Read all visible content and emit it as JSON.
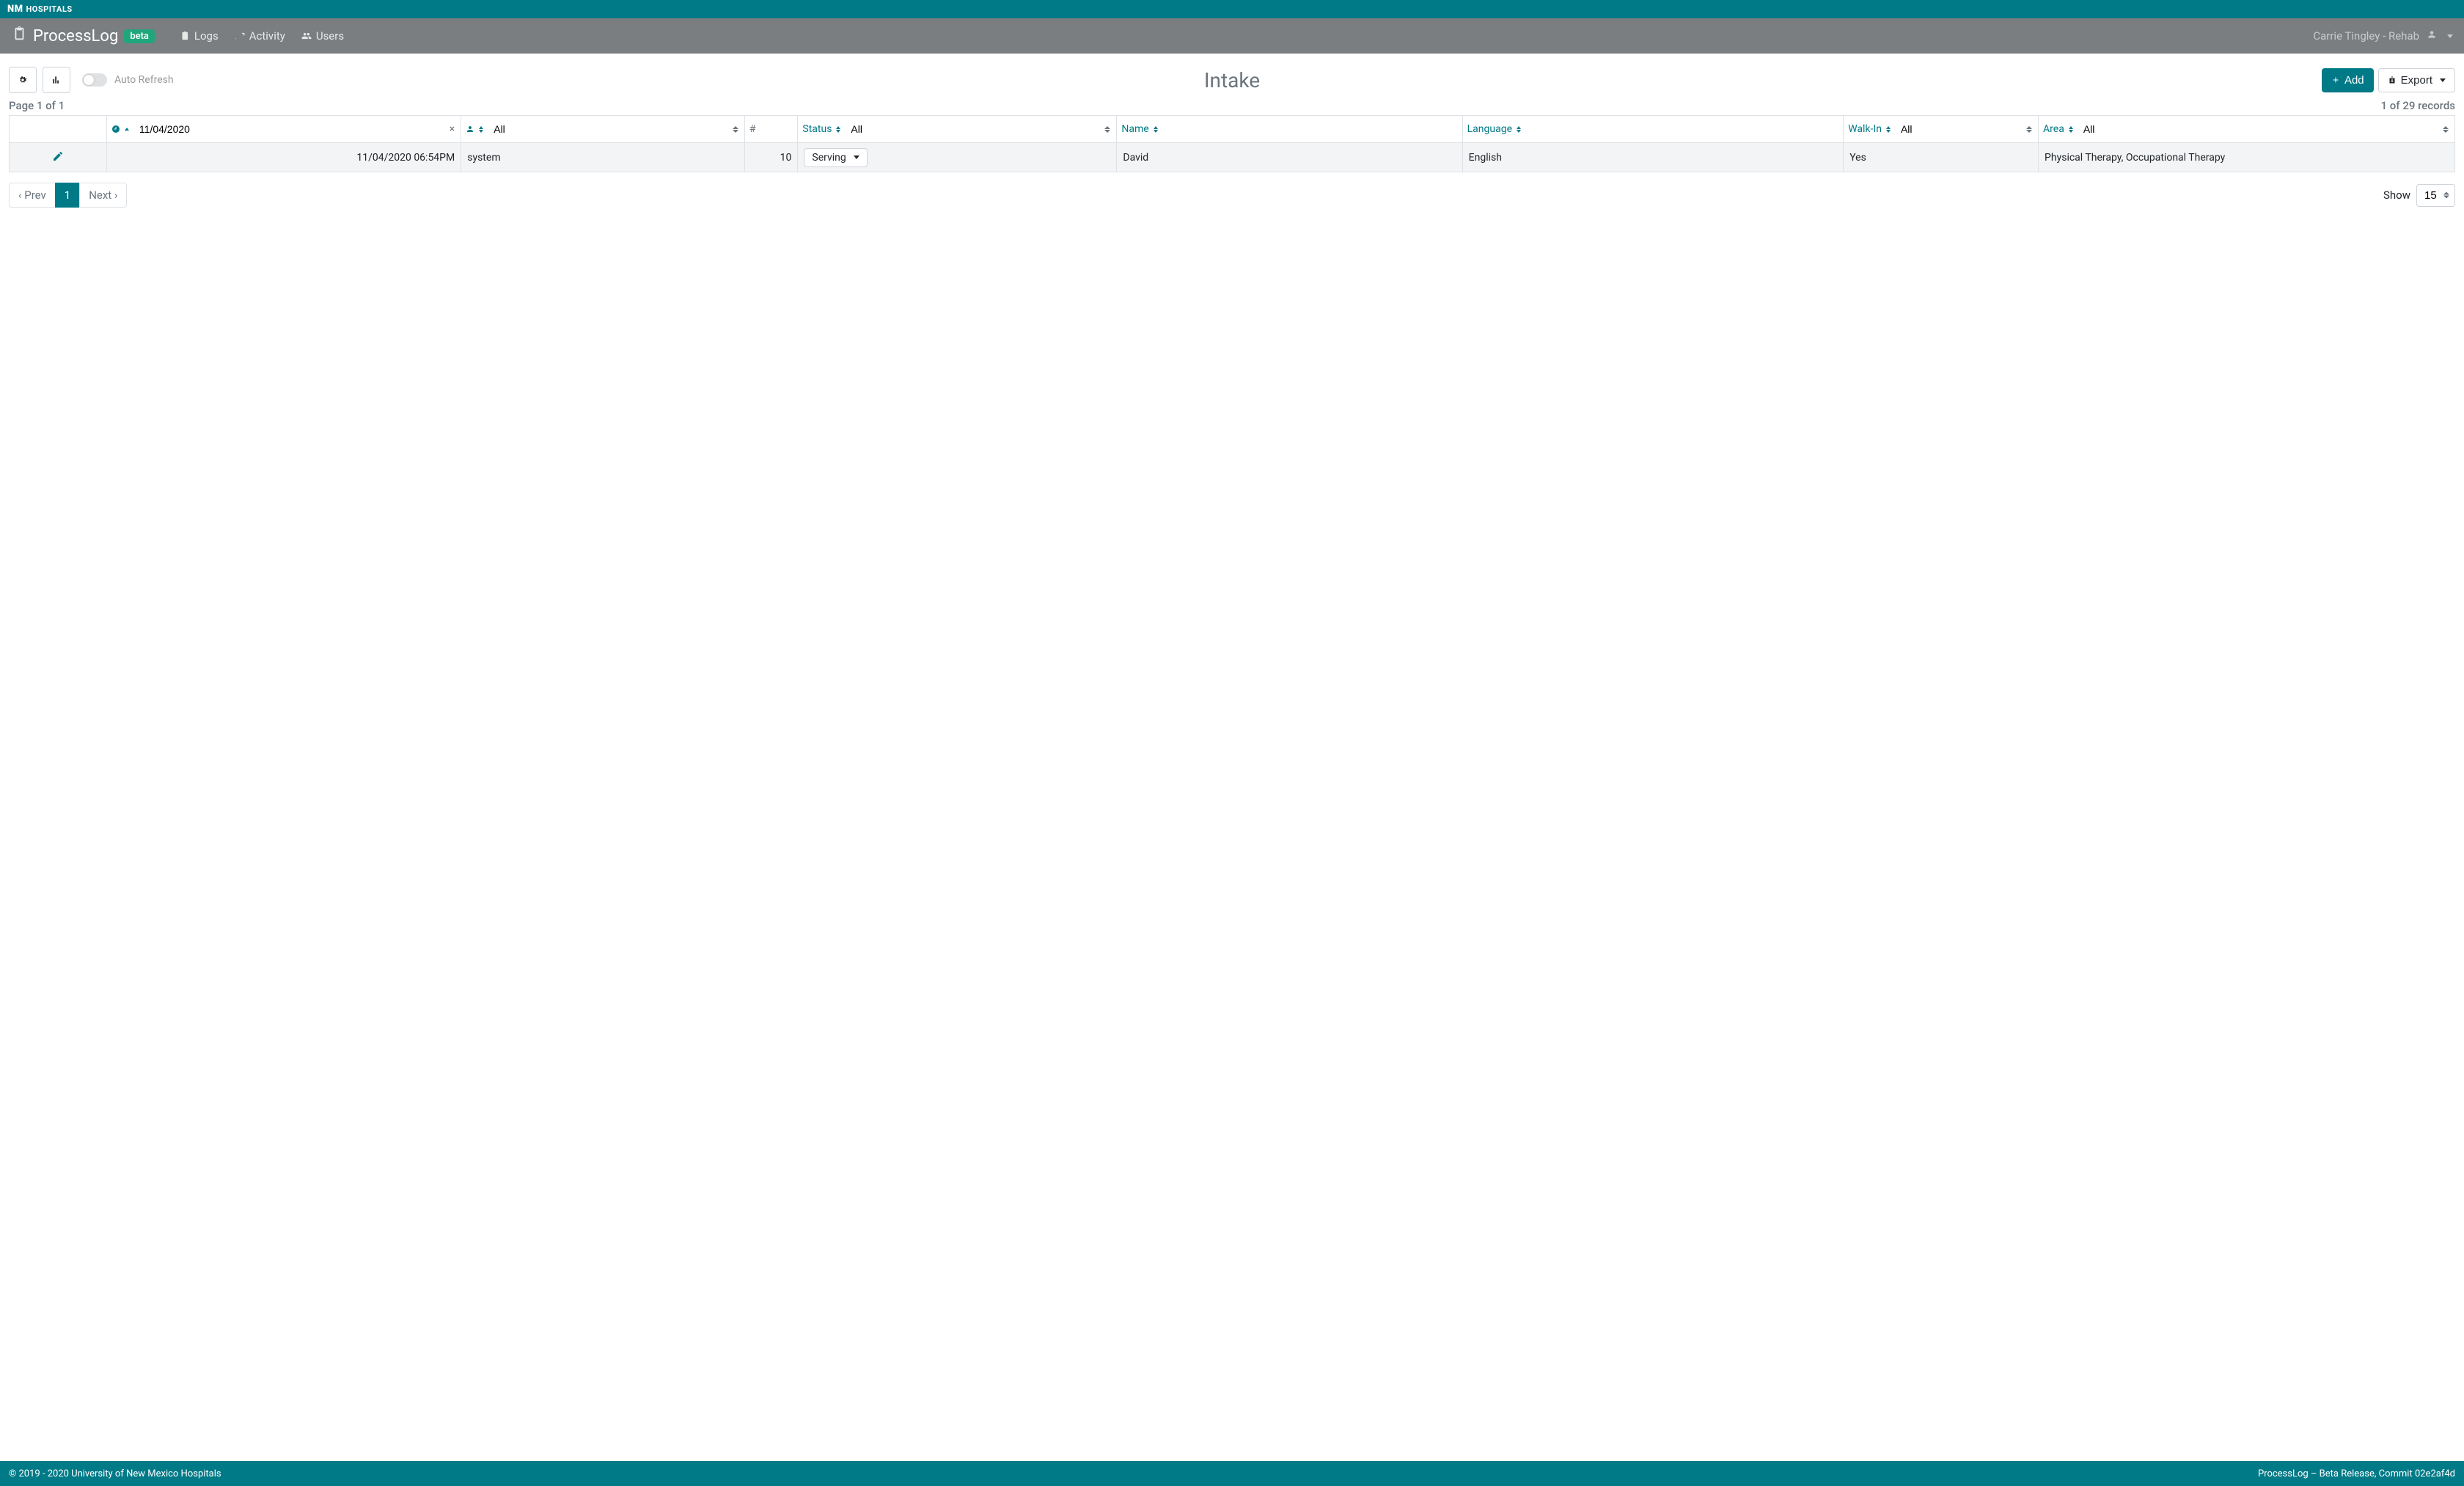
{
  "banner": {
    "org": "HOSPITALS",
    "logoMark": "NM"
  },
  "nav": {
    "brand": "ProcessLog",
    "badge": "beta",
    "links": {
      "logs": "Logs",
      "activity": "Activity",
      "users": "Users"
    },
    "tenant": "Carrie Tingley - Rehab"
  },
  "toolbar": {
    "autoRefresh": "Auto Refresh",
    "title": "Intake",
    "add": "Add",
    "export": "Export"
  },
  "meta": {
    "page": "Page 1 of 1",
    "records": "1 of 29 records"
  },
  "columns": {
    "date_value": "11/04/2020",
    "user_all": "All",
    "hash": "#",
    "status": "Status",
    "status_all": "All",
    "name": "Name",
    "language": "Language",
    "walkin": "Walk-In",
    "walkin_all": "All",
    "area": "Area",
    "area_all": "All"
  },
  "row": {
    "datetime": "11/04/2020 06:54PM",
    "user": "system",
    "num": "10",
    "status": "Serving",
    "name": "David",
    "language": "English",
    "walkin": "Yes",
    "area": "Physical Therapy, Occupational Therapy"
  },
  "pager": {
    "prev": "‹ Prev",
    "p1": "1",
    "next": "Next ›",
    "show": "Show",
    "perPage": "15"
  },
  "footer": {
    "left": "© 2019 - 2020 University of New Mexico Hospitals",
    "right": "ProcessLog – Beta Release, Commit 02e2af4d"
  }
}
